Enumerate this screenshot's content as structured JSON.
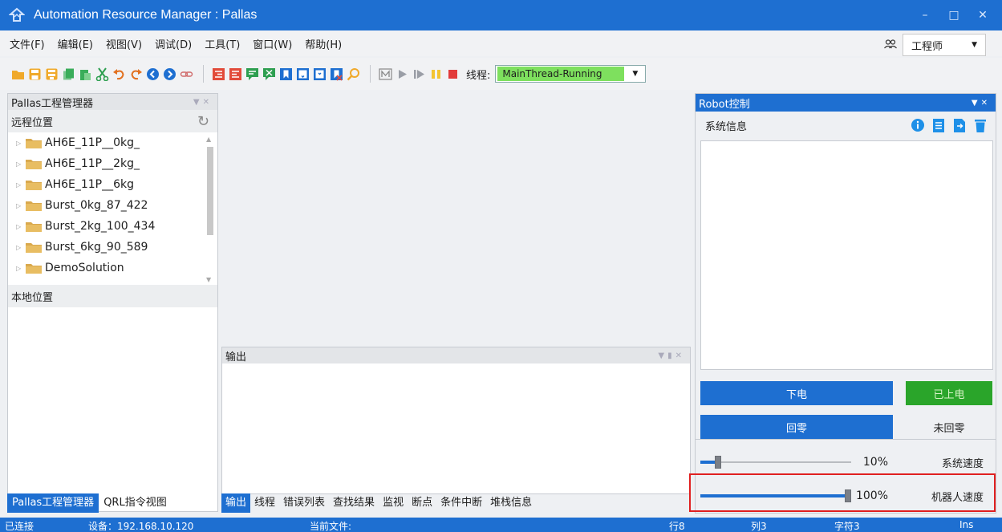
{
  "window": {
    "title": "Automation Resource Manager : Pallas",
    "controls": [
      "minimize",
      "maximize",
      "close"
    ]
  },
  "menu": [
    "文件(F)",
    "编辑(E)",
    "视图(V)",
    "调试(D)",
    "工具(T)",
    "窗口(W)",
    "帮助(H)"
  ],
  "role": {
    "value": "工程师"
  },
  "toolbar": {
    "icons": [
      "open-folder-icon",
      "save-icon",
      "save-all-icon",
      "copy-icon",
      "paste-icon",
      "cut-icon",
      "undo-icon",
      "redo-icon",
      "navigate-back-icon",
      "navigate-forward-icon",
      "link-icon",
      "outdent-icon",
      "indent-icon",
      "comment-icon",
      "uncomment-icon",
      "bookmark-icon",
      "bookmark-prev-icon",
      "bookmark-next-icon",
      "bookmark-clear-icon",
      "find-icon",
      "manual-mode-icon",
      "run-icon",
      "step-icon",
      "pause-icon",
      "stop-icon"
    ],
    "thread_label": "线程:",
    "thread_value": "MainThread-Running",
    "thread_value_bg": "#7ee05e"
  },
  "project_panel": {
    "title": "Pallas工程管理器",
    "remote_header": "远程位置",
    "local_header": "本地位置",
    "items": [
      "AH6E_11P__0kg_",
      "AH6E_11P__2kg_",
      "AH6E_11P__6kg",
      "Burst_0kg_87_422",
      "Burst_2kg_100_434",
      "Burst_6kg_90_589",
      "DemoSolution"
    ]
  },
  "left_tabs": [
    "Pallas工程管理器",
    "QRL指令视图"
  ],
  "output_panel": {
    "title": "输出"
  },
  "bottom_tabs": [
    "输出",
    "线程",
    "错误列表",
    "查找结果",
    "监视",
    "断点",
    "条件中断",
    "堆栈信息"
  ],
  "robot_panel": {
    "title": "Robot控制",
    "sysinfo_label": "系统信息",
    "sysinfo_icons": [
      "info-icon",
      "document-icon",
      "export-icon",
      "delete-icon"
    ],
    "power_off_button": "下电",
    "power_status": "已上电",
    "home_button": "回零",
    "home_status": "未回零",
    "system_speed": {
      "value": "10%",
      "label": "系统速度",
      "level": 0.1
    },
    "robot_speed": {
      "value": "100%",
      "label": "机器人速度",
      "level": 1.0
    }
  },
  "statusbar": {
    "connection": "已连接",
    "device": "设备：192.168.10.120",
    "current_file": "当前文件:",
    "row": "行8",
    "col": "列3",
    "char": "字符3",
    "mode": "Ins"
  },
  "colors": {
    "accent": "#1e6fd1",
    "powered": "#2aa52a",
    "highlight": "#e02020"
  }
}
